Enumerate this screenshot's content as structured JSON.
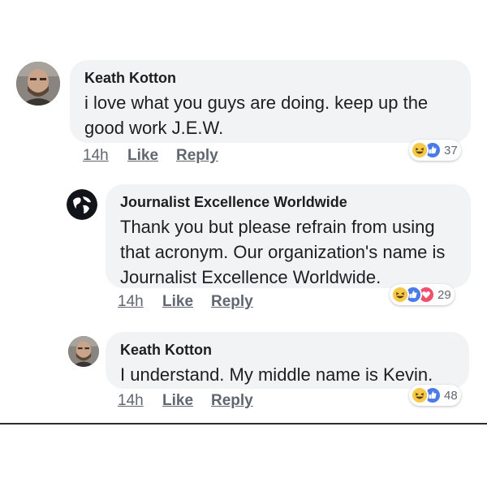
{
  "comments": [
    {
      "author": "Keath Kotton",
      "text": "i love what you guys are doing.  keep up the good work J.E.W.",
      "timestamp": "14h",
      "like_label": "Like",
      "reply_label": "Reply",
      "reaction_count": "37",
      "reactions": [
        "haha",
        "like"
      ]
    },
    {
      "author": "Journalist Excellence Worldwide",
      "text": "Thank you but please refrain from using that acronym. Our organization's name is Journalist Excellence Worldwide.",
      "timestamp": "14h",
      "like_label": "Like",
      "reply_label": "Reply",
      "reaction_count": "29",
      "reactions": [
        "haha",
        "like",
        "love"
      ]
    },
    {
      "author": "Keath Kotton",
      "text": "I understand.  My middle name is Kevin.",
      "timestamp": "14h",
      "like_label": "Like",
      "reply_label": "Reply",
      "reaction_count": "48",
      "reactions": [
        "haha",
        "like"
      ]
    }
  ],
  "colors": {
    "bubble": "#f2f3f5",
    "like_blue": "#4a7be6",
    "love_red": "#f0506e",
    "haha_yellow": "#f7c948",
    "meta_gray": "#606770"
  },
  "icons": {
    "haha": "haha-reaction-icon",
    "like": "like-reaction-icon",
    "love": "love-reaction-icon",
    "avatar_person": "person-avatar",
    "avatar_globe": "globe-logo"
  }
}
